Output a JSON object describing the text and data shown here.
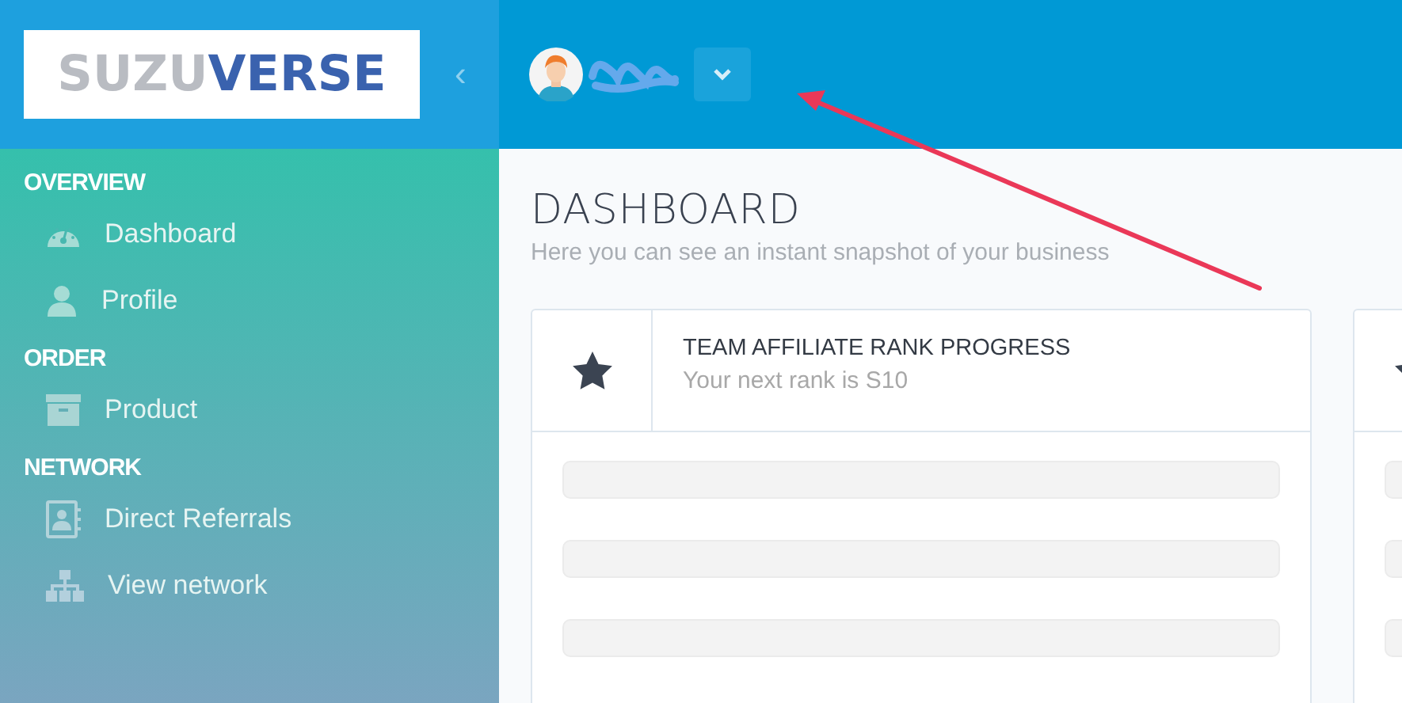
{
  "logo": {
    "part_1": "SUZU",
    "part_2": "VERSE"
  },
  "sidebar": {
    "toggle": "‹",
    "sections": [
      {
        "title": "OVERVIEW",
        "items": [
          {
            "label": "Dashboard"
          },
          {
            "label": "Profile"
          }
        ]
      },
      {
        "title": "ORDER",
        "items": [
          {
            "label": "Product"
          }
        ]
      },
      {
        "title": "NETWORK",
        "items": [
          {
            "label": "Direct Referrals"
          },
          {
            "label": "View network"
          }
        ]
      }
    ]
  },
  "page": {
    "title": "DASHBOARD",
    "subtitle": "Here you can see an instant snapshot of your business"
  },
  "cards": [
    {
      "title": "TEAM AFFILIATE RANK PROGRESS",
      "subtitle": "Your next rank is S10",
      "bars": [
        {
          "level": 0
        },
        {
          "level": 0
        },
        {
          "level": 0
        }
      ]
    },
    {
      "bars": [
        {
          "level": 0
        },
        {
          "level": 0
        },
        {
          "level": 0
        }
      ]
    }
  ]
}
